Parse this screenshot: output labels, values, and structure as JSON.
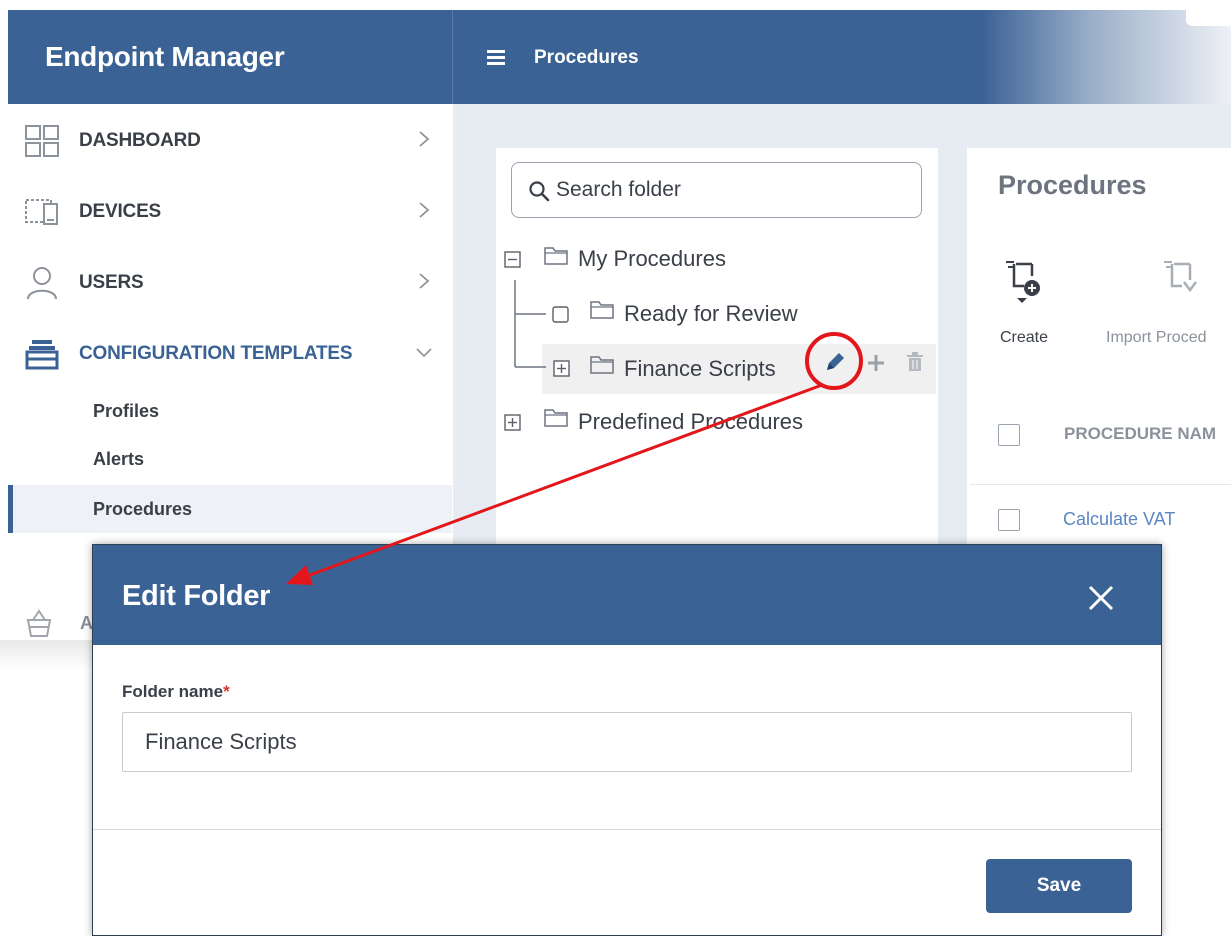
{
  "sidebar": {
    "app_title": "Endpoint Manager",
    "nav": [
      {
        "label": "DASHBOARD",
        "icon": "dashboard-grid-icon"
      },
      {
        "label": "DEVICES",
        "icon": "devices-icon"
      },
      {
        "label": "USERS",
        "icon": "user-icon"
      },
      {
        "label": "CONFIGURATION TEMPLATES",
        "icon": "configuration-templates-icon"
      }
    ],
    "sub_items": [
      {
        "label": "Profiles"
      },
      {
        "label": "Alerts"
      },
      {
        "label": "Procedures",
        "active": true
      }
    ],
    "partial_item_letter": "A"
  },
  "topbar": {
    "title": "Procedures"
  },
  "folder_panel": {
    "search_placeholder": "Search folder",
    "tree": {
      "my_procedures": "My Procedures",
      "ready_for_review": "Ready for Review",
      "finance_scripts": "Finance Scripts",
      "predefined_procedures": "Predefined Procedures"
    }
  },
  "procedures_panel": {
    "title": "Procedures",
    "create_label": "Create",
    "import_label": "Import Proced",
    "column_header": "PROCEDURE NAM",
    "row_link": "Calculate VAT"
  },
  "modal": {
    "title": "Edit Folder",
    "field_label": "Folder name",
    "required_mark": "*",
    "field_value": "Finance Scripts",
    "save_label": "Save"
  },
  "colors": {
    "brand_blue": "#3b6295",
    "annotation_red": "#e3171b",
    "link_blue": "#5a86c3",
    "required_red": "#d2352f"
  }
}
